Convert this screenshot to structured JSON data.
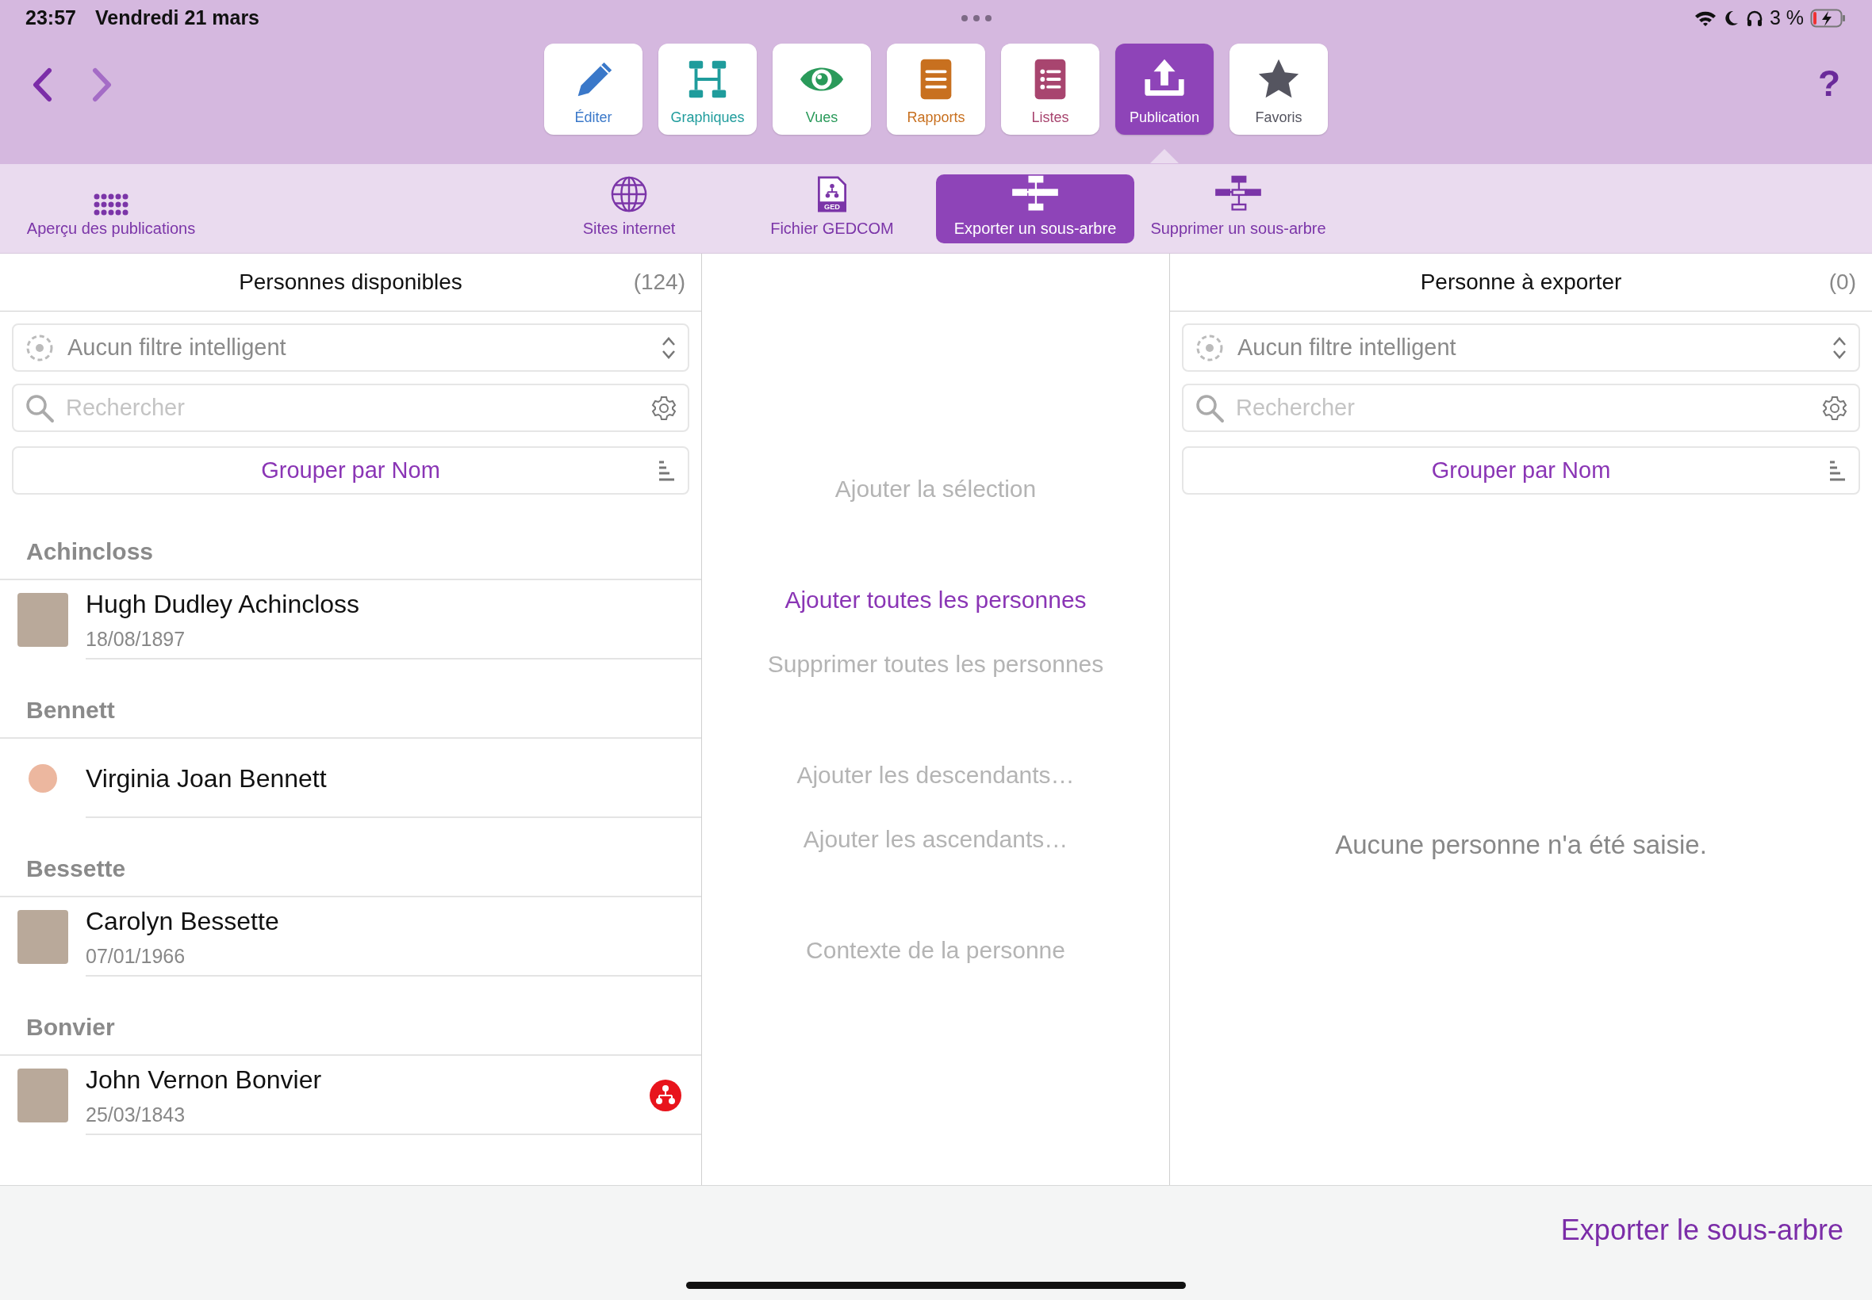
{
  "status_bar": {
    "time": "23:57",
    "date": "Vendredi 21 mars",
    "battery": "3 %"
  },
  "toolbar": {
    "help": "?",
    "tools": [
      {
        "kind": "edit",
        "label": "Éditer",
        "color": "#3a78c9",
        "selected": false
      },
      {
        "kind": "charts",
        "label": "Graphiques",
        "color": "#1f9c9c",
        "selected": false
      },
      {
        "kind": "views",
        "label": "Vues",
        "color": "#2a9a5a",
        "selected": false
      },
      {
        "kind": "reports",
        "label": "Rapports",
        "color": "#c8701f",
        "selected": false
      },
      {
        "kind": "lists",
        "label": "Listes",
        "color": "#a8456f",
        "selected": false
      },
      {
        "kind": "publish",
        "label": "Publication",
        "color": "#8e44b8",
        "selected": true
      },
      {
        "kind": "favorites",
        "label": "Favoris",
        "color": "#555560",
        "selected": false
      }
    ]
  },
  "subtoolbar": {
    "overview": "Aperçu des publications",
    "items": [
      {
        "kind": "globe",
        "label": "Sites internet",
        "selected": false
      },
      {
        "kind": "gedcom",
        "label": "Fichier GEDCOM",
        "icon_text": "GED",
        "selected": false
      },
      {
        "kind": "export",
        "label": "Exporter un sous-arbre",
        "selected": true
      },
      {
        "kind": "delete",
        "label": "Supprimer un sous-arbre",
        "selected": false
      }
    ]
  },
  "available_panel": {
    "title": "Personnes disponibles",
    "count": "(124)",
    "filter": "Aucun filtre intelligent",
    "search_placeholder": "Rechercher",
    "group_button": "Grouper par Nom",
    "sections": [
      {
        "heading": "Achincloss",
        "people": [
          {
            "name": "Hugh Dudley Achincloss",
            "date": "18/08/1897",
            "kind": "photo",
            "badge": false
          }
        ]
      },
      {
        "heading": "Bennett",
        "people": [
          {
            "name": "Virginia Joan Bennett",
            "kind": "placeholder",
            "badge": false
          }
        ]
      },
      {
        "heading": "Bessette",
        "people": [
          {
            "name": "Carolyn Bessette",
            "date": "07/01/1966",
            "kind": "photo",
            "badge": false
          }
        ]
      },
      {
        "heading": "Bonvier",
        "people": [
          {
            "name": "John Vernon Bonvier",
            "date": "25/03/1843",
            "kind": "photo",
            "badge": true
          }
        ]
      }
    ]
  },
  "action_groups": [
    [
      {
        "label": "Ajouter la sélection",
        "disabled": true
      }
    ],
    [
      {
        "label": "Ajouter toutes les personnes",
        "disabled": false
      },
      {
        "label": "Supprimer toutes les personnes",
        "disabled": true
      }
    ],
    [
      {
        "label": "Ajouter les descendants…",
        "disabled": true
      },
      {
        "label": "Ajouter les ascendants…",
        "disabled": true
      }
    ],
    [
      {
        "label": "Contexte de la personne",
        "disabled": true
      }
    ]
  ],
  "export_panel": {
    "title": "Personne à exporter",
    "count": "(0)",
    "filter": "Aucun filtre intelligent",
    "search_placeholder": "Rechercher",
    "group_button": "Grouper par Nom",
    "empty_message": "Aucune personne n'a été saisie."
  },
  "footer": {
    "export_button": "Exporter le sous-arbre"
  }
}
